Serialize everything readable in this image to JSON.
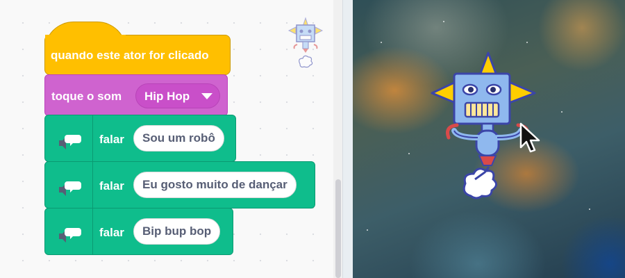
{
  "code_area": {
    "blocks": {
      "hat_label": "quando este ator for clicado",
      "sound_label": "toque o som",
      "sound_value": "Hip Hop",
      "say": [
        {
          "label": "falar",
          "value": "Sou um robô"
        },
        {
          "label": "falar",
          "value": "Eu gosto muito de dançar"
        },
        {
          "label": "falar",
          "value": "Bip bup bop"
        }
      ]
    },
    "sprite_thumbnail_icon": "robot-sprite-icon"
  },
  "stage": {
    "backdrop_icon": "space-nebula",
    "sprite_icon": "robot-sprite-icon",
    "cursor_icon": "mouse-pointer-icon"
  },
  "colors": {
    "events": "#ffbf00",
    "sound": "#cf63cf",
    "looks_extension": "#0fbd8c",
    "pill_text": "#575e75"
  }
}
